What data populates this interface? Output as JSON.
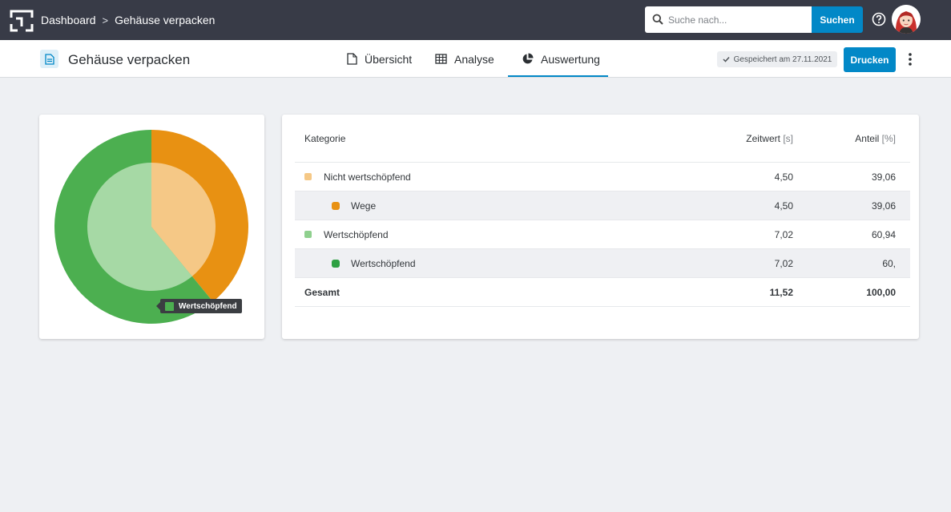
{
  "breadcrumb": {
    "root": "Dashboard",
    "separator": ">",
    "current": "Gehäuse verpacken"
  },
  "search": {
    "placeholder": "Suche nach...",
    "value": "",
    "button": "Suchen"
  },
  "header": {
    "title": "Gehäuse verpacken",
    "tabs": [
      {
        "label": "Übersicht",
        "icon": "document-icon",
        "active": false
      },
      {
        "label": "Analyse",
        "icon": "table-icon",
        "active": false
      },
      {
        "label": "Auswertung",
        "icon": "pie-chart-icon",
        "active": true
      }
    ],
    "saved": "Gespeichert am 27.11.2021",
    "print": "Drucken"
  },
  "colors": {
    "accent": "#0288c7",
    "non_value_outer": "#e89112",
    "non_value_inner": "#f5c886",
    "value_outer": "#4caf50",
    "value_inner": "#a6d9a5"
  },
  "chart_data": {
    "type": "pie",
    "rings": [
      {
        "name": "inner",
        "labels": [
          "Nicht wertschöpfend",
          "Wertschöpfend"
        ],
        "values": [
          39.06,
          60.94
        ]
      },
      {
        "name": "outer",
        "labels": [
          "Wege",
          "Wertschöpfend"
        ],
        "values": [
          39.06,
          60.94
        ]
      }
    ],
    "tooltip": "Wertschöpfend"
  },
  "table": {
    "headers": {
      "category": "Kategorie",
      "time": "Zeitwert",
      "time_unit": "[s]",
      "share": "Anteil",
      "share_unit": "[%]"
    },
    "rows": [
      {
        "label": "Nicht wertschöpfend",
        "time": "4,50",
        "share": "39,06",
        "level": 0,
        "color": "#f5c886"
      },
      {
        "label": "Wege",
        "time": "4,50",
        "share": "39,06",
        "level": 1,
        "color": "#e89112"
      },
      {
        "label": "Wertschöpfend",
        "time": "7,02",
        "share": "60,94",
        "level": 0,
        "color": "#8fd08e"
      },
      {
        "label": "Wertschöpfend",
        "time": "7,02",
        "share": "60,",
        "level": 1,
        "color": "#2ea043"
      }
    ],
    "total": {
      "label": "Gesamt",
      "time": "11,52",
      "share": "100,00"
    }
  }
}
